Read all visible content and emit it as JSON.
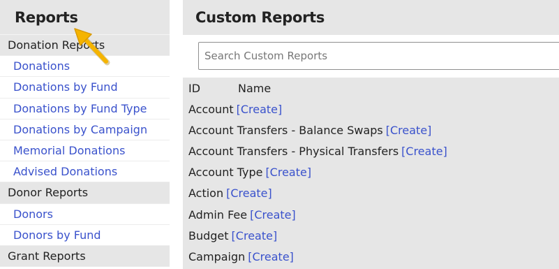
{
  "sidebar": {
    "title": "Reports",
    "rows": [
      {
        "type": "section",
        "label": "Donation Reports"
      },
      {
        "type": "link",
        "label": "Donations"
      },
      {
        "type": "link",
        "label": "Donations by Fund"
      },
      {
        "type": "link",
        "label": "Donations by Fund Type"
      },
      {
        "type": "link",
        "label": "Donations by Campaign"
      },
      {
        "type": "link",
        "label": "Memorial Donations"
      },
      {
        "type": "link",
        "label": "Advised Donations"
      },
      {
        "type": "section",
        "label": "Donor Reports"
      },
      {
        "type": "link",
        "label": "Donors"
      },
      {
        "type": "link",
        "label": "Donors by Fund"
      },
      {
        "type": "section",
        "label": "Grant Reports"
      }
    ]
  },
  "main": {
    "title": "Custom Reports",
    "search": {
      "placeholder": "Search Custom Reports",
      "value": ""
    },
    "columns": {
      "id": "ID",
      "name": "Name"
    },
    "create_label": "[Create]",
    "reports": [
      "Account",
      "Account Transfers - Balance Swaps",
      "Account Transfers - Physical Transfers",
      "Account Type",
      "Action",
      "Admin Fee",
      "Budget",
      "Campaign"
    ]
  },
  "colors": {
    "link": "#3a52cc",
    "panel_bg": "#e6e6e6",
    "arrow": "#f5b400"
  }
}
